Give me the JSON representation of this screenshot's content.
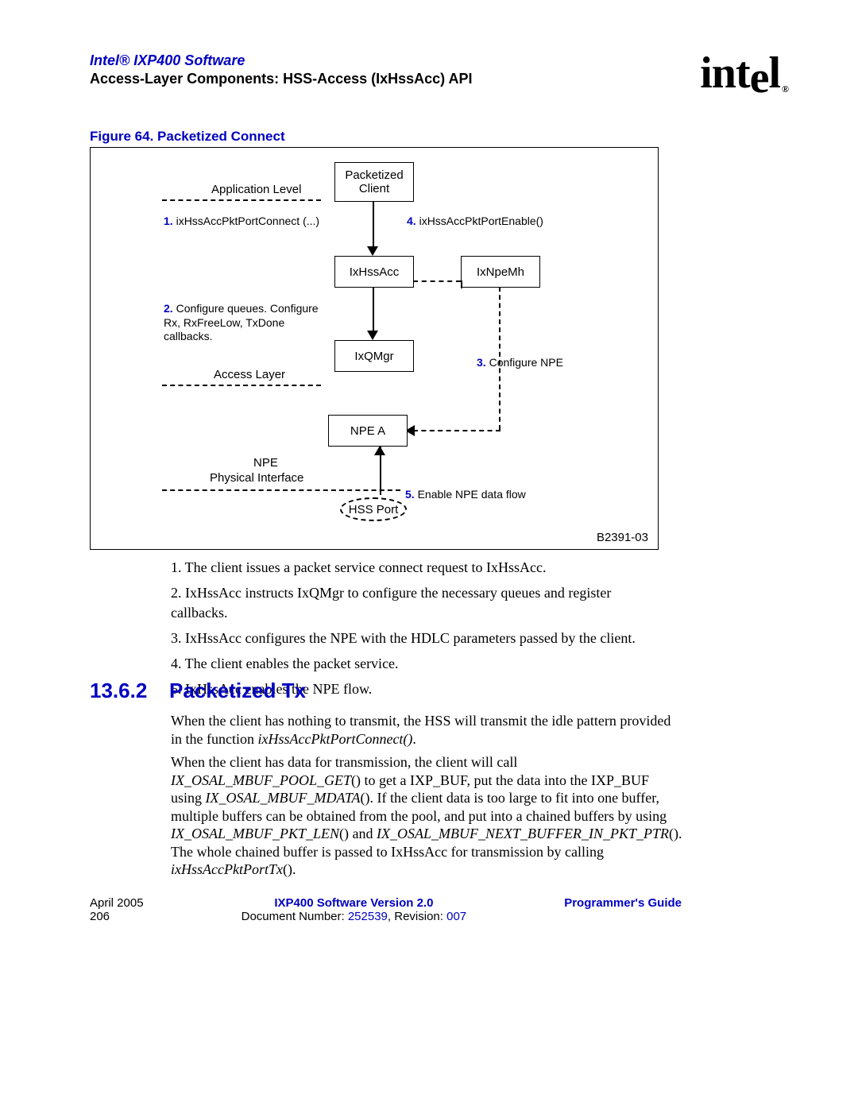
{
  "header": {
    "title": "Intel® IXP400 Software",
    "subtitle": "Access-Layer Components: HSS-Access (IxHssAcc) API",
    "logo_text": "intel",
    "logo_r": "®"
  },
  "figure": {
    "caption": "Figure 64. Packetized Connect",
    "code": "B2391-03",
    "labels": {
      "app_level": "Application Level",
      "access_layer": "Access Layer",
      "npe_label": "NPE",
      "phys_iface": "Physical Interface"
    },
    "boxes": {
      "pkt_client": "Packetized\nClient",
      "ixhssacc": "IxHssAcc",
      "ixnpemh": "IxNpeMh",
      "ixqmgr": "IxQMgr",
      "npea": "NPE A",
      "hssport": "HSS Port"
    },
    "steps": {
      "s1_num": "1.",
      "s1_txt": " ixHssAccPktPortConnect (...)",
      "s2_num": "2.",
      "s2_txt": " Configure queues. Configure Rx, RxFreeLow, TxDone callbacks.",
      "s3_num": "3.",
      "s3_txt": " Configure NPE",
      "s4_num": "4.",
      "s4_txt": " ixHssAccPktPortEnable()",
      "s5_num": "5.",
      "s5_txt": " Enable NPE data flow"
    }
  },
  "list": {
    "i1": "1.  The client issues a packet service connect request to IxHssAcc.",
    "i2": "2.  IxHssAcc instructs IxQMgr to configure the necessary queues and register callbacks.",
    "i3": "3.  IxHssAcc configures the NPE with the HDLC parameters passed by the client.",
    "i4": "4.  The client enables the packet service.",
    "i5": "5.  IxHssAcc enables the NPE flow."
  },
  "section": {
    "num": "13.6.2",
    "title": "Packetized Tx"
  },
  "paragraphs": {
    "p1a": "When the client has nothing to transmit, the HSS will transmit the idle pattern provided in the function ",
    "p1b": "ixHssAccPktPortConnect()",
    "p1c": ".",
    "p2a": "When the client has data for transmission, the client will call ",
    "p2b": "IX_OSAL_MBUF_POOL_GET",
    "p2c": "() to get a IXP_BUF, put the data into the IXP_BUF using ",
    "p2d": "IX_OSAL_MBUF_MDATA",
    "p2e": "(). If the client data is too large to fit into one buffer, multiple buffers can be obtained from the pool, and put into a chained buffers by using ",
    "p2f": "IX_OSAL_MBUF_PKT_LEN",
    "p2g": "() and ",
    "p2h": "IX_OSAL_MBUF_NEXT_BUFFER_IN_PKT_PTR",
    "p2i": "(). The whole chained buffer is passed to IxHssAcc for transmission by calling ",
    "p2j": "ixHssAccPktPortTx",
    "p2k": "()."
  },
  "footer": {
    "date": "April 2005",
    "page": "206",
    "center_bold": "IXP400 Software Version 2.0",
    "docnum_label": "Document Number: ",
    "docnum": "252539",
    "rev_label": ", Revision: ",
    "rev": "007",
    "guide": "Programmer's Guide"
  }
}
